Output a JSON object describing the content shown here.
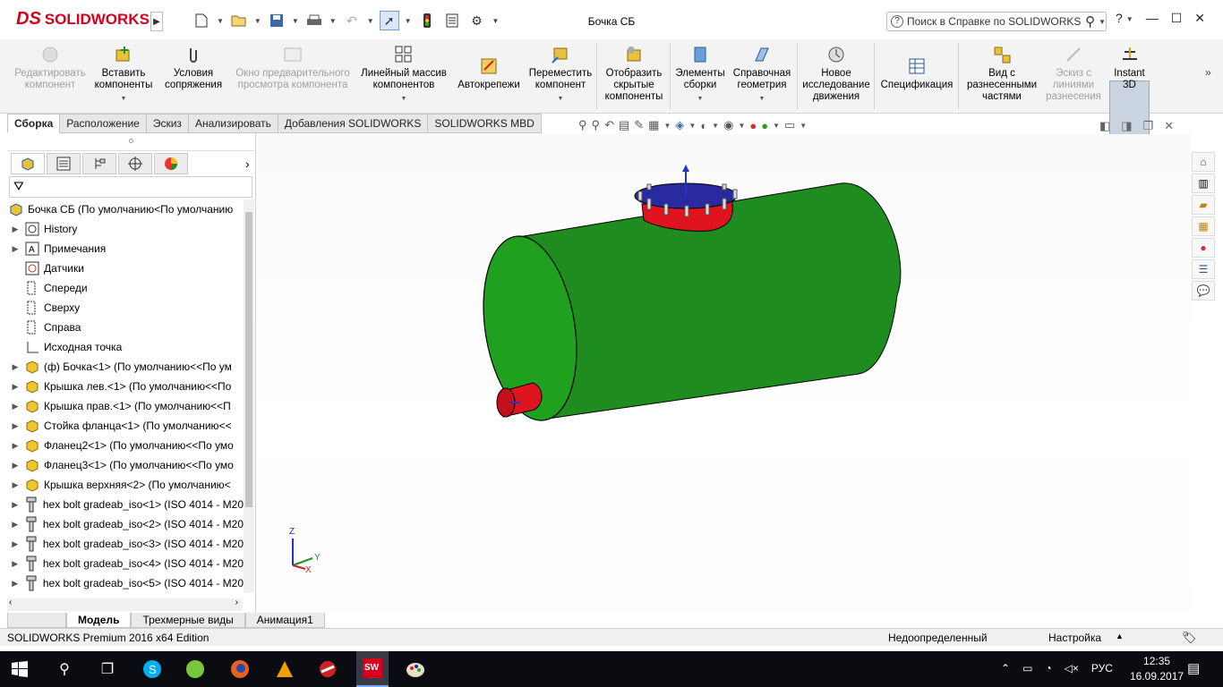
{
  "app": {
    "brand_prefix": "DS",
    "brand": "SOLIDWORKS",
    "window_title": "Бочка СБ"
  },
  "help": {
    "placeholder": "Поиск в Справке по SOLIDWORKS",
    "question": "?"
  },
  "commands": [
    {
      "label": "Редактировать компонент",
      "enabled": false
    },
    {
      "label": "Вставить компоненты",
      "enabled": true
    },
    {
      "label": "Условия сопряжения",
      "enabled": true
    },
    {
      "label": "Окно предварительного просмотра компонента",
      "enabled": false
    },
    {
      "label": "Линейный массив компонентов",
      "enabled": true
    },
    {
      "label": "Автокрепежи",
      "enabled": true
    },
    {
      "label": "Переместить компонент",
      "enabled": true
    },
    {
      "label": "Отобразить скрытые компоненты",
      "enabled": true
    },
    {
      "label": "Элементы сборки",
      "enabled": true
    },
    {
      "label": "Справочная геометрия",
      "enabled": true
    },
    {
      "label": "Новое исследование движения",
      "enabled": true
    },
    {
      "label": "Спецификация",
      "enabled": true
    },
    {
      "label": "Вид с разнесенными частями",
      "enabled": true
    },
    {
      "label": "Эскиз с линиями разнесения",
      "enabled": false
    },
    {
      "label": "Instant 3D",
      "enabled": true
    }
  ],
  "tabs": [
    "Сборка",
    "Расположение",
    "Эскиз",
    "Анализировать",
    "Добавления SOLIDWORKS",
    "SOLIDWORKS MBD"
  ],
  "tree": {
    "root": "Бочка СБ  (По умолчанию<По умолчанию",
    "items": [
      {
        "label": "History",
        "icon": "history-icon",
        "expand": true
      },
      {
        "label": "Примечания",
        "icon": "annotations-icon",
        "expand": true
      },
      {
        "label": "Датчики",
        "icon": "sensor-icon",
        "expand": false
      },
      {
        "label": "Спереди",
        "icon": "plane-icon",
        "expand": false
      },
      {
        "label": "Сверху",
        "icon": "plane-icon",
        "expand": false
      },
      {
        "label": "Справа",
        "icon": "plane-icon",
        "expand": false
      },
      {
        "label": "Исходная точка",
        "icon": "origin-icon",
        "expand": false
      },
      {
        "label": "(ф) Бочка<1> (По умолчанию<<По ум",
        "icon": "part-icon",
        "expand": true
      },
      {
        "label": "Крышка лев.<1> (По умолчанию<<По",
        "icon": "part-icon",
        "expand": true
      },
      {
        "label": "Крышка прав.<1> (По умолчанию<<П",
        "icon": "part-icon",
        "expand": true
      },
      {
        "label": "Стойка фланца<1> (По умолчанию<<",
        "icon": "part-icon",
        "expand": true
      },
      {
        "label": "Фланец2<1> (По умолчанию<<По умо",
        "icon": "part-icon",
        "expand": true
      },
      {
        "label": "Фланец3<1> (По умолчанию<<По умо",
        "icon": "part-icon",
        "expand": true
      },
      {
        "label": "Крышка верхняя<2> (По умолчанию<",
        "icon": "part-icon",
        "expand": true
      },
      {
        "label": "hex bolt gradeab_iso<1> (ISO 4014 - M20",
        "icon": "bolt-icon",
        "expand": true
      },
      {
        "label": "hex bolt gradeab_iso<2> (ISO 4014 - M20",
        "icon": "bolt-icon",
        "expand": true
      },
      {
        "label": "hex bolt gradeab_iso<3> (ISO 4014 - M20",
        "icon": "bolt-icon",
        "expand": true
      },
      {
        "label": "hex bolt gradeab_iso<4> (ISO 4014 - M20",
        "icon": "bolt-icon",
        "expand": true
      },
      {
        "label": "hex bolt gradeab_iso<5> (ISO 4014 - M20",
        "icon": "bolt-icon",
        "expand": true
      }
    ]
  },
  "bottom_tabs": [
    "Модель",
    "Трехмерные виды",
    "Анимация1"
  ],
  "status": {
    "edition": "SOLIDWORKS Premium 2016 x64 Edition",
    "state": "Недоопределенный",
    "settings": "Настройка"
  },
  "triad": {
    "x": "X",
    "y": "Y",
    "z": "Z"
  },
  "taskbar": {
    "lang": "РУС",
    "time": "12:35",
    "date": "16.09.2017"
  },
  "colors": {
    "body": "#1e8c1e",
    "flange": "#e0141e",
    "cover": "#2a2aa0",
    "accent": "#d6001c"
  }
}
